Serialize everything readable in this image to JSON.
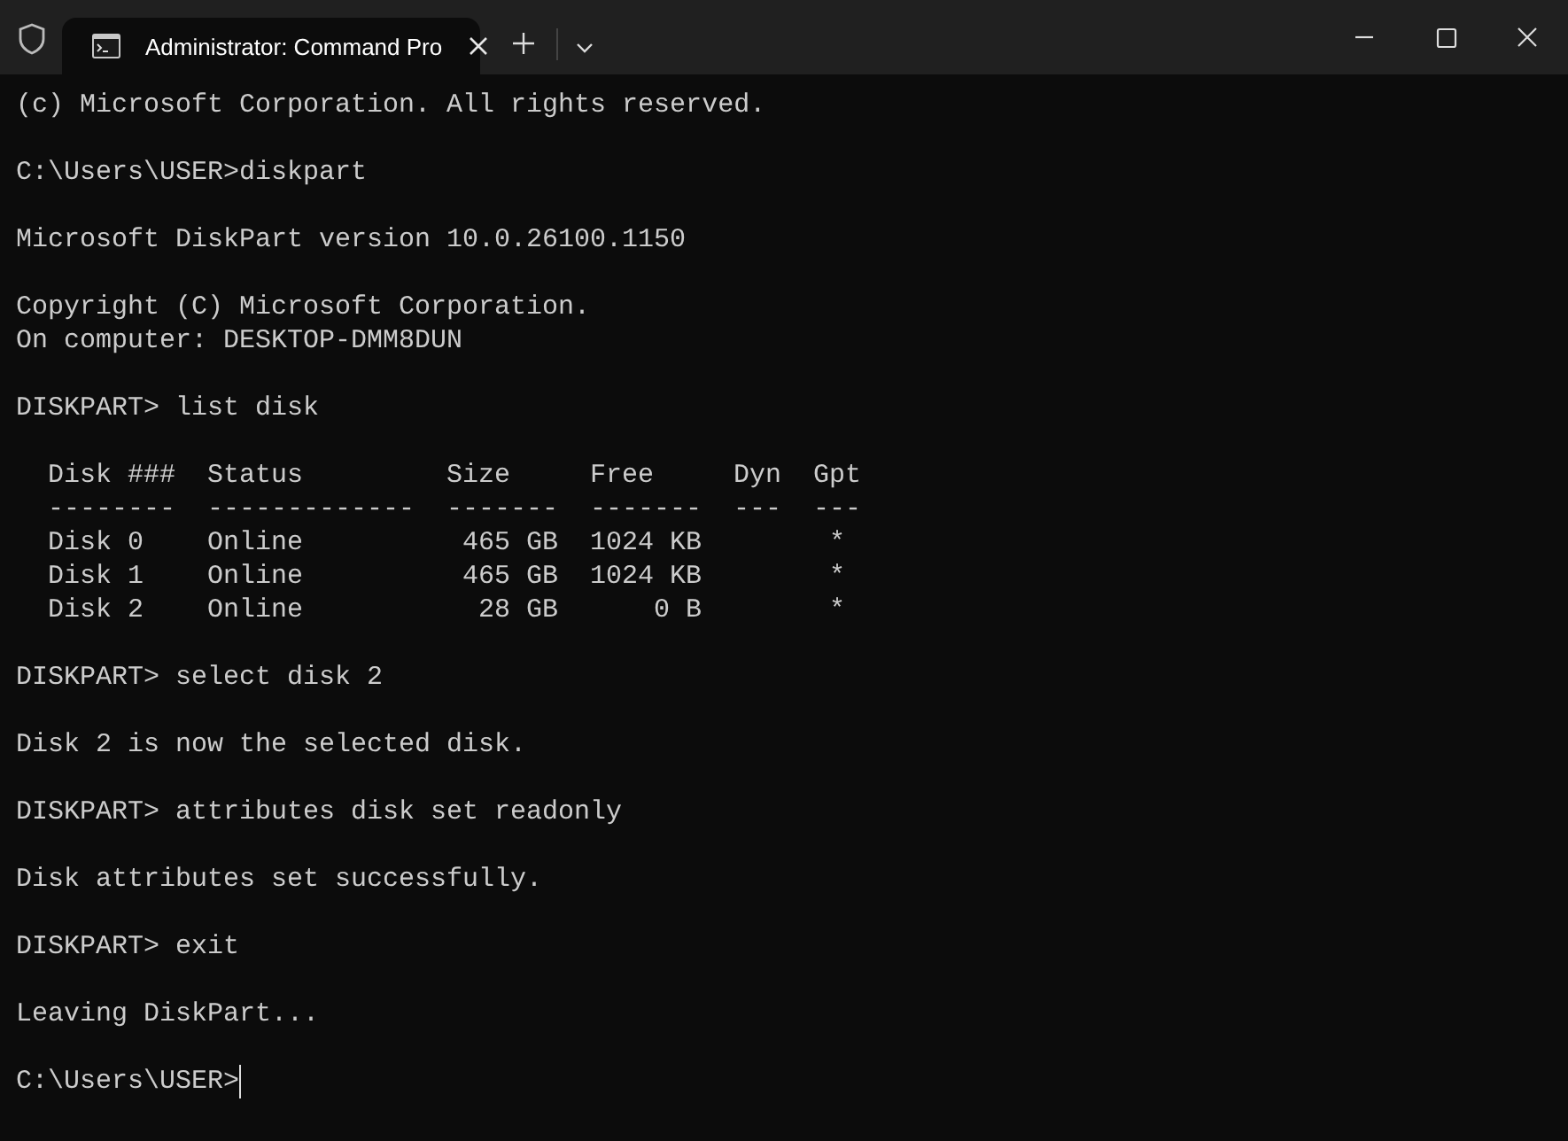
{
  "window": {
    "tabs": [
      {
        "title": "Administrator: Command Pro",
        "selected": true
      }
    ]
  },
  "console": {
    "blocks": [
      {
        "kind": "text",
        "lines": [
          "(c) Microsoft Corporation. All rights reserved."
        ]
      },
      {
        "kind": "text",
        "lines": [
          "C:\\Users\\USER>diskpart"
        ]
      },
      {
        "kind": "text",
        "lines": [
          "Microsoft DiskPart version 10.0.26100.1150"
        ]
      },
      {
        "kind": "text",
        "lines": [
          "Copyright (C) Microsoft Corporation.",
          "On computer: DESKTOP-DMM8DUN"
        ]
      },
      {
        "kind": "text",
        "lines": [
          "DISKPART> list disk"
        ]
      },
      {
        "kind": "table",
        "columns": [
          {
            "label": "Disk ###",
            "rule": "--------"
          },
          {
            "label": "Status",
            "rule": "-------------"
          },
          {
            "label": "Size",
            "rule": "-------"
          },
          {
            "label": "Free",
            "rule": "-------"
          },
          {
            "label": "Dyn",
            "rule": "---"
          },
          {
            "label": "Gpt",
            "rule": "---"
          }
        ],
        "rows": [
          [
            "Disk 0",
            "Online",
            "465 GB",
            "1024 KB",
            null,
            "*"
          ],
          [
            "Disk 1",
            "Online",
            "465 GB",
            "1024 KB",
            null,
            "*"
          ],
          [
            "Disk 2",
            "Online",
            "28 GB",
            "0 B",
            null,
            "*"
          ]
        ]
      },
      {
        "kind": "text",
        "lines": [
          "DISKPART> select disk 2"
        ]
      },
      {
        "kind": "text",
        "lines": [
          "Disk 2 is now the selected disk."
        ]
      },
      {
        "kind": "text",
        "lines": [
          "DISKPART> attributes disk set readonly"
        ]
      },
      {
        "kind": "text",
        "lines": [
          "Disk attributes set successfully."
        ]
      },
      {
        "kind": "text",
        "lines": [
          "DISKPART> exit"
        ]
      },
      {
        "kind": "text",
        "lines": [
          "Leaving DiskPart..."
        ]
      },
      {
        "kind": "prompt",
        "text": "C:\\Users\\USER>"
      }
    ]
  }
}
